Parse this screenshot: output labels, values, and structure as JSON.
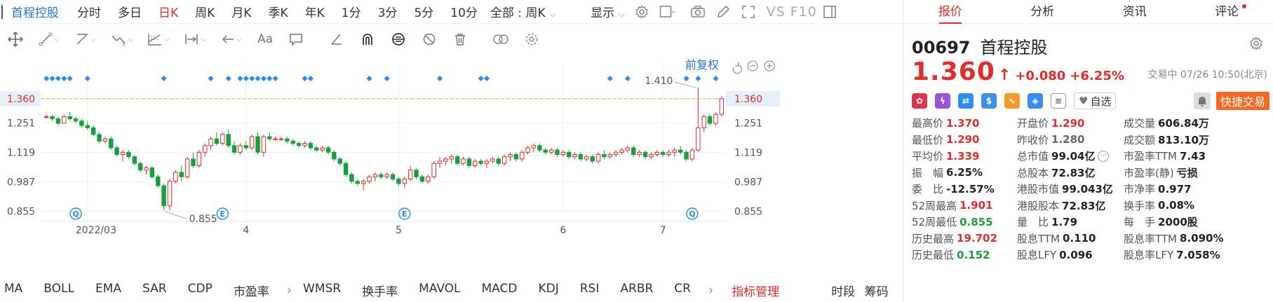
{
  "period_bar": {
    "stock_name": "首程控股",
    "periods": [
      "分时",
      "多日",
      "日K",
      "周K",
      "月K",
      "季K",
      "年K",
      "1分",
      "3分",
      "5分",
      "10分"
    ],
    "active_period": "日K",
    "all_select": "全部 : 周K",
    "display_label": "显示",
    "vs_label": "VS",
    "f10_label": "F10"
  },
  "chart": {
    "adjust_label": "前复权",
    "price_labels": [
      "1.360",
      "1.251",
      "1.119",
      "0.987",
      "0.855"
    ],
    "date_labels": [
      "2022/03",
      "4",
      "5",
      "6",
      "7"
    ],
    "current_price": 1.36,
    "annot_high": "1.410",
    "annot_low": "0.855",
    "event_markers": [
      "Q",
      "E",
      "E",
      "Q"
    ],
    "colors": {
      "up": "#e32c2c",
      "down": "#18a03e",
      "current_line": "#f5a04a",
      "marker": "#2a8cf2"
    }
  },
  "chart_data": {
    "type": "candlestick",
    "y_ticks": [
      1.36,
      1.251,
      1.119,
      0.987,
      0.855
    ],
    "ylim": [
      0.81,
      1.52
    ],
    "current_price": 1.36,
    "ohlc": [
      [
        1.28,
        1.29,
        1.27,
        1.28
      ],
      [
        1.28,
        1.29,
        1.26,
        1.27
      ],
      [
        1.27,
        1.28,
        1.24,
        1.25
      ],
      [
        1.25,
        1.29,
        1.25,
        1.28
      ],
      [
        1.28,
        1.3,
        1.26,
        1.27
      ],
      [
        1.27,
        1.28,
        1.25,
        1.26
      ],
      [
        1.26,
        1.27,
        1.23,
        1.24
      ],
      [
        1.24,
        1.26,
        1.22,
        1.23
      ],
      [
        1.23,
        1.24,
        1.19,
        1.2
      ],
      [
        1.2,
        1.21,
        1.16,
        1.17
      ],
      [
        1.17,
        1.19,
        1.16,
        1.18
      ],
      [
        1.18,
        1.19,
        1.13,
        1.14
      ],
      [
        1.14,
        1.15,
        1.1,
        1.11
      ],
      [
        1.11,
        1.13,
        1.08,
        1.12
      ],
      [
        1.12,
        1.13,
        1.09,
        1.1
      ],
      [
        1.1,
        1.11,
        1.06,
        1.07
      ],
      [
        1.07,
        1.08,
        1.03,
        1.04
      ],
      [
        1.04,
        1.06,
        1.02,
        1.05
      ],
      [
        1.05,
        1.06,
        1.0,
        1.01
      ],
      [
        1.01,
        1.02,
        0.96,
        0.97
      ],
      [
        0.97,
        0.98,
        0.86,
        0.88
      ],
      [
        0.88,
        1.0,
        0.86,
        0.99
      ],
      [
        0.99,
        1.04,
        0.98,
        1.03
      ],
      [
        1.03,
        1.06,
        0.99,
        1.01
      ],
      [
        1.01,
        1.1,
        1.0,
        1.09
      ],
      [
        1.09,
        1.12,
        1.05,
        1.06
      ],
      [
        1.06,
        1.13,
        1.05,
        1.12
      ],
      [
        1.12,
        1.16,
        1.1,
        1.15
      ],
      [
        1.15,
        1.19,
        1.13,
        1.18
      ],
      [
        1.18,
        1.21,
        1.15,
        1.16
      ],
      [
        1.16,
        1.21,
        1.15,
        1.2
      ],
      [
        1.2,
        1.22,
        1.14,
        1.15
      ],
      [
        1.15,
        1.17,
        1.11,
        1.12
      ],
      [
        1.12,
        1.16,
        1.11,
        1.15
      ],
      [
        1.15,
        1.17,
        1.13,
        1.14
      ],
      [
        1.14,
        1.2,
        1.13,
        1.19
      ],
      [
        1.19,
        1.21,
        1.11,
        1.12
      ],
      [
        1.12,
        1.2,
        1.1,
        1.19
      ],
      [
        1.19,
        1.21,
        1.17,
        1.18
      ],
      [
        1.18,
        1.19,
        1.17,
        1.18
      ],
      [
        1.18,
        1.19,
        1.17,
        1.18
      ],
      [
        1.18,
        1.19,
        1.16,
        1.17
      ],
      [
        1.17,
        1.18,
        1.15,
        1.16
      ],
      [
        1.16,
        1.17,
        1.14,
        1.15
      ],
      [
        1.15,
        1.17,
        1.14,
        1.16
      ],
      [
        1.16,
        1.17,
        1.13,
        1.14
      ],
      [
        1.14,
        1.15,
        1.12,
        1.13
      ],
      [
        1.13,
        1.15,
        1.12,
        1.14
      ],
      [
        1.14,
        1.15,
        1.11,
        1.12
      ],
      [
        1.12,
        1.13,
        1.08,
        1.09
      ],
      [
        1.09,
        1.1,
        1.06,
        1.07
      ],
      [
        1.07,
        1.08,
        1.01,
        1.02
      ],
      [
        1.02,
        1.03,
        0.98,
        0.99
      ],
      [
        0.99,
        1.0,
        0.97,
        0.98
      ],
      [
        0.98,
        1.0,
        0.95,
        0.99
      ],
      [
        0.99,
        1.02,
        0.98,
        1.01
      ],
      [
        1.01,
        1.03,
        0.99,
        1.02
      ],
      [
        1.02,
        1.03,
        1.0,
        1.01
      ],
      [
        1.01,
        1.03,
        1.0,
        1.02
      ],
      [
        1.02,
        1.03,
        0.99,
        1.0
      ],
      [
        1.0,
        1.01,
        0.97,
        0.98
      ],
      [
        0.98,
        1.01,
        0.96,
        1.0
      ],
      [
        1.0,
        1.06,
        0.99,
        1.04
      ],
      [
        1.04,
        1.05,
        1.0,
        1.01
      ],
      [
        1.01,
        1.02,
        0.98,
        0.99
      ],
      [
        0.99,
        1.02,
        0.98,
        1.01
      ],
      [
        1.01,
        1.08,
        1.0,
        1.07
      ],
      [
        1.07,
        1.1,
        1.05,
        1.08
      ],
      [
        1.08,
        1.1,
        1.06,
        1.09
      ],
      [
        1.09,
        1.11,
        1.07,
        1.1
      ],
      [
        1.1,
        1.11,
        1.06,
        1.07
      ],
      [
        1.07,
        1.1,
        1.06,
        1.09
      ],
      [
        1.09,
        1.1,
        1.05,
        1.06
      ],
      [
        1.06,
        1.09,
        1.05,
        1.08
      ],
      [
        1.08,
        1.09,
        1.06,
        1.07
      ],
      [
        1.07,
        1.09,
        1.05,
        1.08
      ],
      [
        1.08,
        1.1,
        1.07,
        1.09
      ],
      [
        1.09,
        1.1,
        1.06,
        1.07
      ],
      [
        1.07,
        1.11,
        1.06,
        1.1
      ],
      [
        1.1,
        1.12,
        1.08,
        1.11
      ],
      [
        1.11,
        1.12,
        1.08,
        1.09
      ],
      [
        1.09,
        1.13,
        1.08,
        1.12
      ],
      [
        1.12,
        1.15,
        1.11,
        1.14
      ],
      [
        1.14,
        1.16,
        1.12,
        1.15
      ],
      [
        1.15,
        1.16,
        1.12,
        1.13
      ],
      [
        1.13,
        1.14,
        1.11,
        1.12
      ],
      [
        1.12,
        1.14,
        1.11,
        1.13
      ],
      [
        1.13,
        1.14,
        1.1,
        1.11
      ],
      [
        1.11,
        1.13,
        1.1,
        1.12
      ],
      [
        1.12,
        1.13,
        1.09,
        1.1
      ],
      [
        1.1,
        1.12,
        1.09,
        1.11
      ],
      [
        1.11,
        1.12,
        1.08,
        1.09
      ],
      [
        1.09,
        1.11,
        1.08,
        1.1
      ],
      [
        1.1,
        1.11,
        1.07,
        1.08
      ],
      [
        1.08,
        1.12,
        1.07,
        1.11
      ],
      [
        1.11,
        1.13,
        1.09,
        1.1
      ],
      [
        1.1,
        1.12,
        1.09,
        1.11
      ],
      [
        1.11,
        1.13,
        1.1,
        1.12
      ],
      [
        1.12,
        1.14,
        1.11,
        1.13
      ],
      [
        1.13,
        1.15,
        1.12,
        1.14
      ],
      [
        1.14,
        1.15,
        1.1,
        1.11
      ],
      [
        1.11,
        1.13,
        1.1,
        1.12
      ],
      [
        1.12,
        1.13,
        1.09,
        1.1
      ],
      [
        1.1,
        1.12,
        1.09,
        1.11
      ],
      [
        1.11,
        1.13,
        1.1,
        1.12
      ],
      [
        1.12,
        1.13,
        1.1,
        1.11
      ],
      [
        1.11,
        1.13,
        1.1,
        1.12
      ],
      [
        1.12,
        1.14,
        1.1,
        1.13
      ],
      [
        1.13,
        1.15,
        1.11,
        1.12
      ],
      [
        1.12,
        1.13,
        1.08,
        1.09
      ],
      [
        1.09,
        1.14,
        1.08,
        1.13
      ],
      [
        1.13,
        1.41,
        1.12,
        1.23
      ],
      [
        1.23,
        1.29,
        1.21,
        1.28
      ],
      [
        1.28,
        1.29,
        1.24,
        1.25
      ],
      [
        1.25,
        1.3,
        1.24,
        1.29
      ],
      [
        1.29,
        1.37,
        1.28,
        1.36
      ]
    ]
  },
  "draw_tools": [
    "crosshair-icon",
    "line-icon",
    "polygon-icon",
    "wave-icon",
    "fib-icon",
    "range-icon",
    "arrow-left-icon",
    "text-icon",
    "comment-icon",
    "ruler-icon",
    "magnet-icon",
    "lock-icon",
    "hide-icon",
    "trash-icon",
    "link-icon",
    "settings-icon"
  ],
  "indicators": {
    "left": [
      "MA",
      "BOLL",
      "EMA",
      "SAR",
      "CDP",
      "市盈率"
    ],
    "right": [
      "WMSR",
      "换手率",
      "MAVOL",
      "MACD",
      "KDJ",
      "RSI",
      "ARBR",
      "CR"
    ],
    "manager": "指标管理",
    "extra": [
      "时段",
      "筹码"
    ]
  },
  "quote": {
    "tabs": [
      "报价",
      "分析",
      "资讯",
      "评论"
    ],
    "active_tab": "报价",
    "code": "00697",
    "name": "首程控股",
    "price": "1.360",
    "change": "+0.080",
    "change_pct": "+6.25%",
    "status": "交易中 07/26 10:50(北京)",
    "watch_label": "自选",
    "fast_trade_label": "快捷交易",
    "stats": [
      [
        {
          "label": "最高价",
          "value": "1.370",
          "color": "red"
        },
        {
          "label": "开盘价",
          "value": "1.290",
          "color": "red"
        },
        {
          "label": "成交量",
          "value": "606.84万",
          "color": ""
        }
      ],
      [
        {
          "label": "最低价",
          "value": "1.290",
          "color": "red"
        },
        {
          "label": "昨收价",
          "value": "1.280",
          "color": "gray"
        },
        {
          "label": "成交额",
          "value": "813.10万",
          "color": ""
        }
      ],
      [
        {
          "label": "平均价",
          "value": "1.339",
          "color": "red"
        },
        {
          "label": "总市值",
          "value": "99.04亿",
          "color": "",
          "dot": "···"
        },
        {
          "label": "市盈率TTM",
          "value": "7.43",
          "color": ""
        }
      ],
      [
        {
          "label": "振　幅",
          "value": "6.25%",
          "color": ""
        },
        {
          "label": "总股本",
          "value": "72.83亿",
          "color": ""
        },
        {
          "label": "市盈率(静)",
          "value": "亏损",
          "color": ""
        }
      ],
      [
        {
          "label": "委　比",
          "value": "-12.57%",
          "color": ""
        },
        {
          "label": "港股市值",
          "value": "99.043亿",
          "color": ""
        },
        {
          "label": "市净率",
          "value": "0.977",
          "color": ""
        }
      ],
      [
        {
          "label": "52周最高",
          "value": "1.901",
          "color": "red"
        },
        {
          "label": "港股股本",
          "value": "72.83亿",
          "color": ""
        },
        {
          "label": "换手率",
          "value": "0.08%",
          "color": ""
        }
      ],
      [
        {
          "label": "52周最低",
          "value": "0.855",
          "color": "green"
        },
        {
          "label": "量　比",
          "value": "1.79",
          "color": ""
        },
        {
          "label": "每　手",
          "value": "2000股",
          "color": ""
        }
      ],
      [
        {
          "label": "历史最高",
          "value": "19.702",
          "color": "red"
        },
        {
          "label": "股息TTM",
          "value": "0.110",
          "color": ""
        },
        {
          "label": "股息率TTM",
          "value": "8.090%",
          "color": ""
        }
      ],
      [
        {
          "label": "历史最低",
          "value": "0.152",
          "color": "green"
        },
        {
          "label": "股息LFY",
          "value": "0.096",
          "color": ""
        },
        {
          "label": "股息率LFY",
          "value": "7.058%",
          "color": ""
        }
      ]
    ]
  }
}
